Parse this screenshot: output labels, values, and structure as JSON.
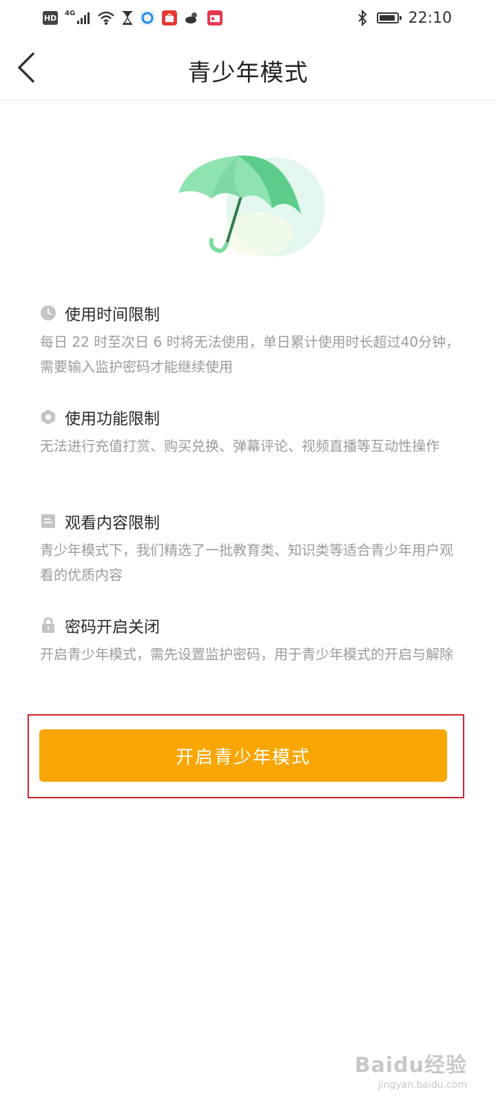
{
  "status_bar": {
    "network_badge": "HD",
    "network_type": "4G",
    "time": "22:10",
    "icons": [
      "hd-icon",
      "signal-icon",
      "wifi-icon",
      "hourglass-icon",
      "browser-app-icon",
      "shop-app-icon",
      "weather-icon",
      "calendar-app-icon",
      "bluetooth-icon",
      "battery-icon"
    ]
  },
  "nav": {
    "title": "青少年模式",
    "back_icon": "chevron-left-icon"
  },
  "illustration": {
    "icon": "umbrella-icon",
    "colors": {
      "canopy_light": "#8fe3b1",
      "canopy_dark": "#5ccc8b",
      "handle": "#2f7a4a",
      "halo": "#e3f7ee"
    }
  },
  "features": [
    {
      "icon": "clock-icon",
      "title": "使用时间限制",
      "desc": "每日 22 时至次日 6 时将无法使用，单日累计使用时长超过40分钟，需要输入监护密码才能继续使用"
    },
    {
      "icon": "hexagon-icon",
      "title": "使用功能限制",
      "desc": "无法进行充值打赏、购买兑换、弹幕评论、视频直播等互动性操作"
    },
    {
      "icon": "document-icon",
      "title": "观看内容限制",
      "desc": "青少年模式下，我们精选了一批教育类、知识类等适合青少年用户观看的优质内容"
    },
    {
      "icon": "lock-icon",
      "title": "密码开启关闭",
      "desc": "开启青少年模式，需先设置监护密码，用于青少年模式的开启与解除"
    }
  ],
  "primary_button": {
    "label": "开启青少年模式",
    "color": "#f9a602"
  },
  "watermark": {
    "brand": "Baidu经验",
    "url": "jingyan.baidu.com"
  }
}
